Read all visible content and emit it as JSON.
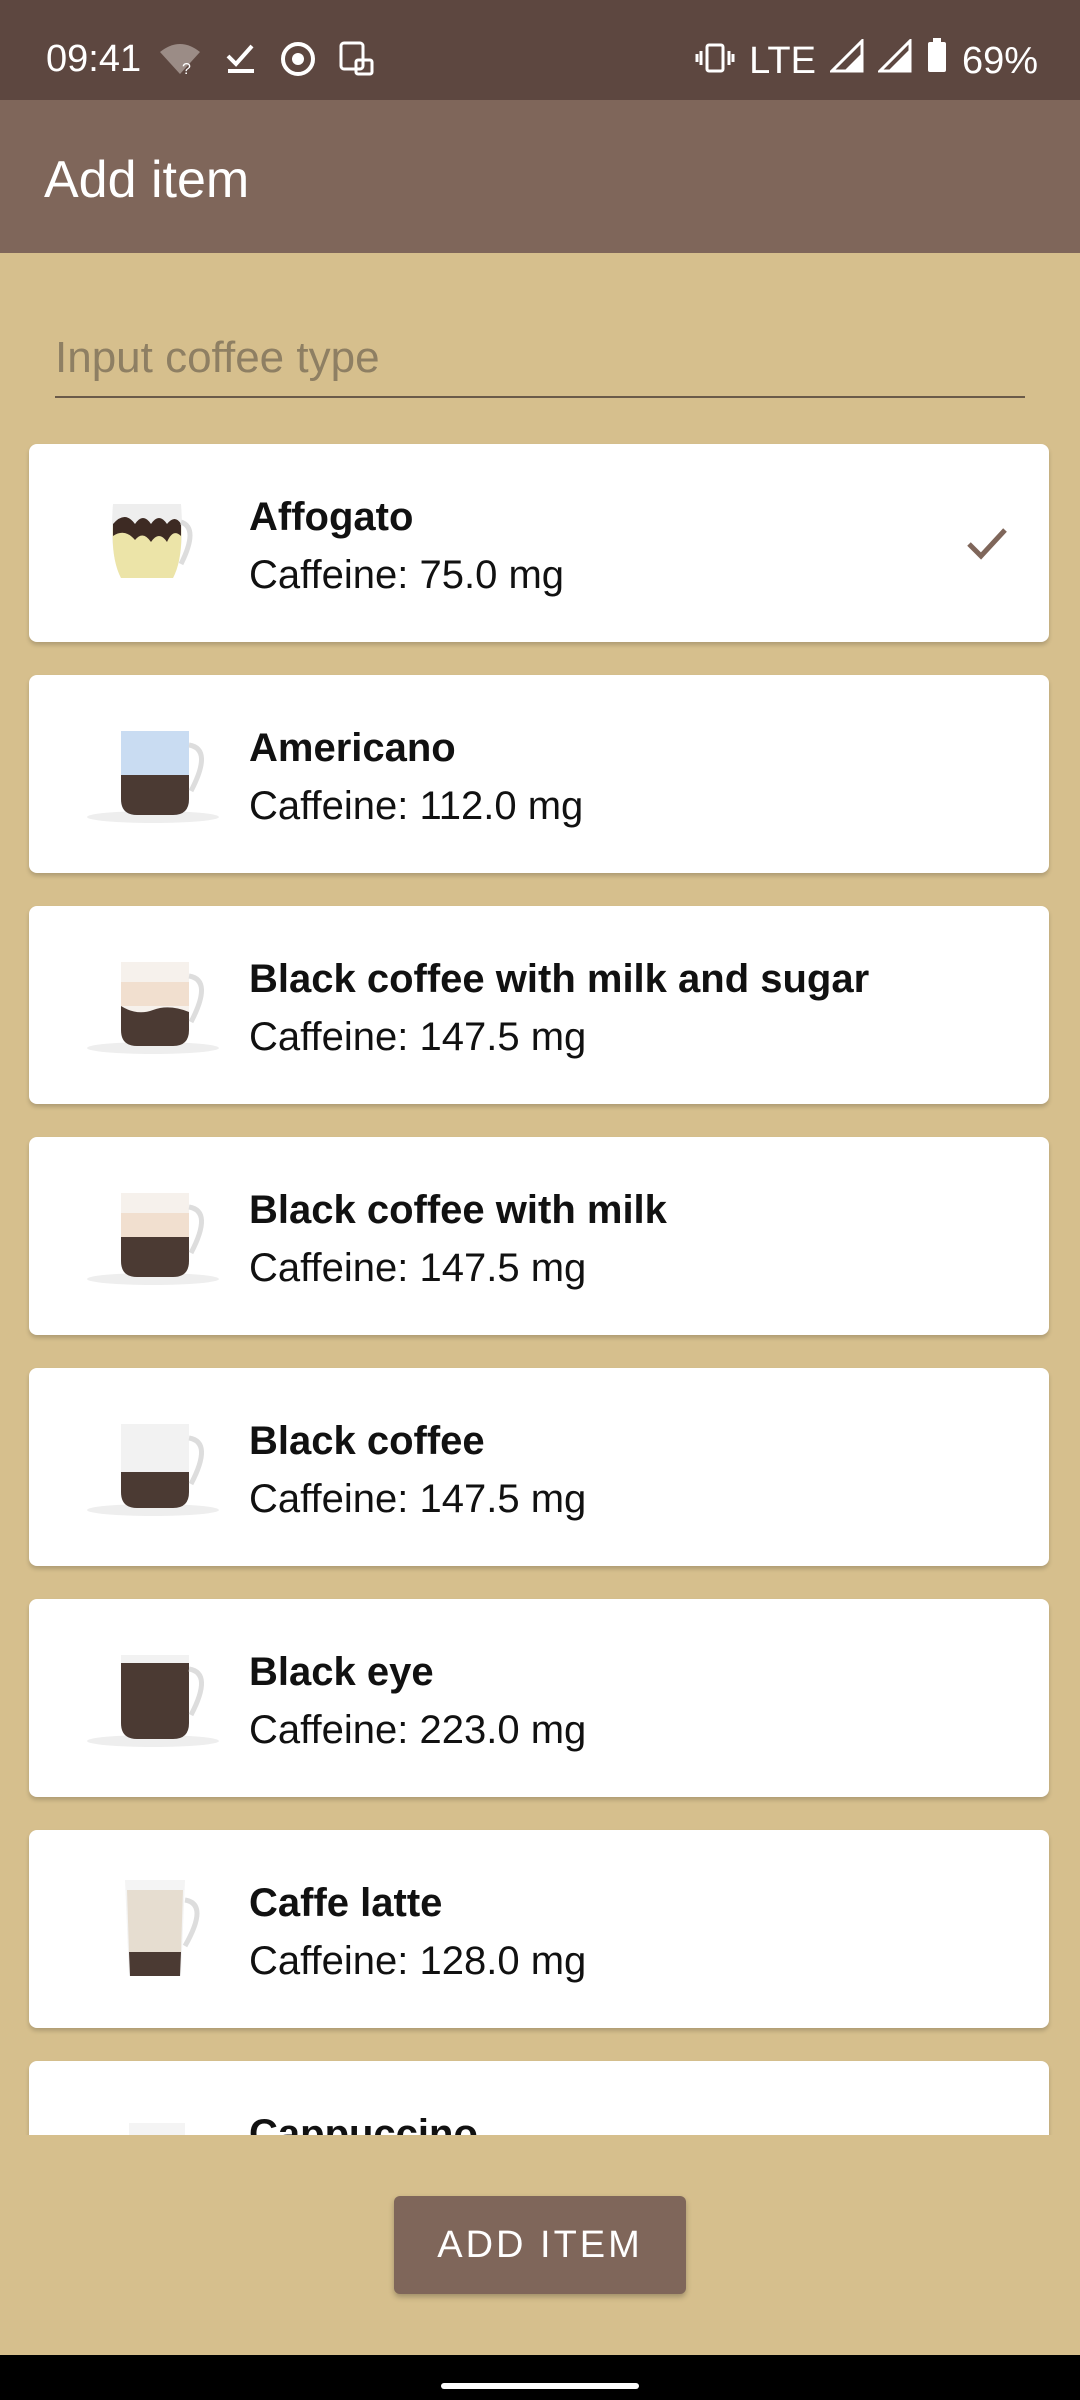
{
  "status_bar": {
    "time": "09:41",
    "network": "LTE",
    "battery": "69%",
    "icons": [
      "wifi-question-icon",
      "checkmark-icon",
      "chrome-icon",
      "app-notification-icon",
      "vibrate-icon",
      "signal-icon",
      "signal-icon",
      "battery-icon"
    ]
  },
  "app_bar": {
    "title": "Add item"
  },
  "search": {
    "placeholder": "Input coffee type",
    "value": ""
  },
  "items": [
    {
      "name": "Affogato",
      "caffeine": "Caffeine: 75.0 mg",
      "selected": true,
      "cup": "affogato-cup-icon"
    },
    {
      "name": "Americano",
      "caffeine": "Caffeine: 112.0 mg",
      "selected": false,
      "cup": "americano-cup-icon"
    },
    {
      "name": "Black coffee with milk and sugar",
      "caffeine": "Caffeine: 147.5 mg",
      "selected": false,
      "cup": "milk-sugar-cup-icon"
    },
    {
      "name": "Black coffee with milk",
      "caffeine": "Caffeine: 147.5 mg",
      "selected": false,
      "cup": "milk-cup-icon"
    },
    {
      "name": "Black coffee",
      "caffeine": "Caffeine: 147.5 mg",
      "selected": false,
      "cup": "black-coffee-cup-icon"
    },
    {
      "name": "Black eye",
      "caffeine": "Caffeine: 223.0 mg",
      "selected": false,
      "cup": "black-eye-cup-icon"
    },
    {
      "name": "Caffe latte",
      "caffeine": "Caffeine: 128.0 mg",
      "selected": false,
      "cup": "latte-cup-icon"
    },
    {
      "name": "Cappuccino",
      "caffeine": "",
      "selected": false,
      "cup": "cappuccino-cup-icon"
    }
  ],
  "add_button": {
    "label": "ADD ITEM"
  },
  "colors": {
    "status_bar": "#5d4740",
    "app_bar": "#7f665a",
    "background": "#d6bf8d",
    "accent": "#7f665a"
  }
}
